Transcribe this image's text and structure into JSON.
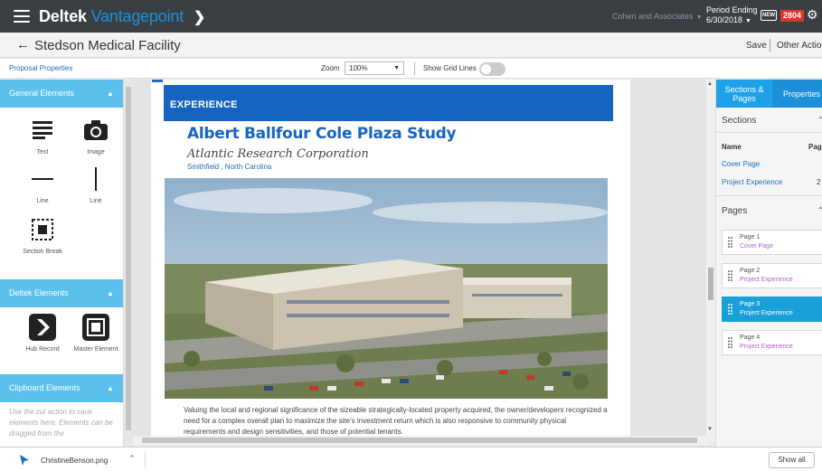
{
  "topbar": {
    "brand_main": "Deltek",
    "brand_product": "Vantagepoint",
    "brand_chevron": "❯",
    "company": "Cohen and Associates",
    "period_label": "Period Ending",
    "period_date": "6/30/2018",
    "new_badge": "NEW",
    "notification_count": "2804",
    "icons": [
      "hamburger-icon",
      "chevron-right-icon",
      "gear-icon"
    ]
  },
  "titlebar": {
    "back_arrow": "←",
    "title": "Stedson Medical Facility",
    "save_label": "Save",
    "other_actions_label": "Other Actions"
  },
  "toolbar": {
    "proposal_properties": "Proposal Properties",
    "zoom_label": "Zoom",
    "zoom_value": "100%",
    "grid_lines_label": "Show Grid Lines",
    "grid_lines_on": false
  },
  "left_sidebar": {
    "general_title": "General Elements",
    "tools": {
      "text": "Text",
      "image": "Image",
      "line_h": "Line",
      "line_v": "Line",
      "section_break": "Section Break"
    },
    "deltek_title": "Deltek Elements",
    "deltek_tools": {
      "hub_record": "Hub Record",
      "master_element": "Master Element"
    },
    "clipboard_title": "Clipboard Elements",
    "clipboard_note": "Use the cut action to save elements here. Elements can be dragged from the"
  },
  "document": {
    "section_heading": "EXPERIENCE",
    "project_title": "Albert Ballfour Cole Plaza Study",
    "client": "Atlantic Research Corporation",
    "location": "Smithfield , North Carolina",
    "description": "Valuing the local and regional significance of the sizeable strategically-located property acquired, the owner/developers recognized a need for a complex overall plan to maximize the site's investment return which is also responsive to community physical requirements and design sensitivities, and those of potential tenants."
  },
  "right_panel": {
    "tab_sections": "Sections & Pages",
    "tab_properties": "Properties",
    "sections_title": "Sections",
    "col_name": "Name",
    "col_pages": "Pages",
    "sections": [
      {
        "name": "Cover Page",
        "pages": ""
      },
      {
        "name": "Project Experience",
        "pages": "2"
      }
    ],
    "pages_title": "Pages",
    "pages": [
      {
        "title": "Page 1",
        "section": "Cover Page"
      },
      {
        "title": "Page 2",
        "section": "Project Experience"
      },
      {
        "title": "Page 3",
        "section": "Project Experience"
      },
      {
        "title": "Page 4",
        "section": "Project Experience"
      }
    ],
    "active_page_index": 2
  },
  "downloads": {
    "filename": "ChristineBenson.png",
    "show_all": "Show all"
  },
  "colors": {
    "topbar": "#3a3f44",
    "brand_accent": "#1e90d9",
    "sidebar_header": "#5bc0eb",
    "doc_blue": "#1565c0",
    "active_page": "#1aa0d8",
    "badge_red": "#d9372b"
  }
}
